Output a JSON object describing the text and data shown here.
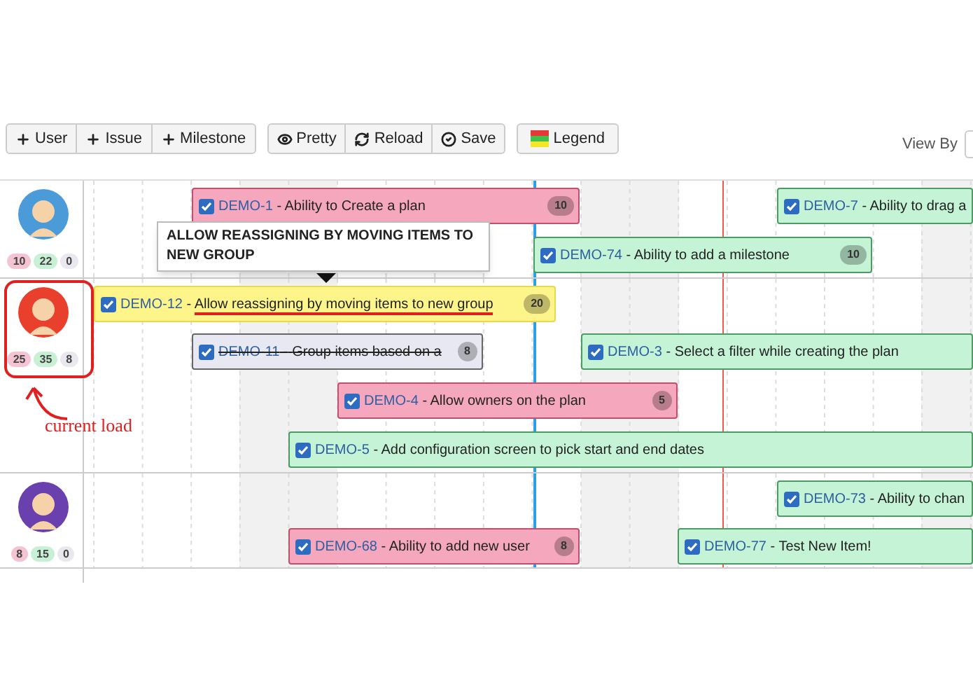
{
  "toolbar": {
    "groups": [
      {
        "buttons": [
          "User",
          "Issue",
          "Milestone"
        ]
      },
      {
        "buttons": [
          "Pretty",
          "Reload",
          "Save"
        ]
      },
      {
        "buttons": [
          "Legend"
        ]
      }
    ],
    "view_by": "View By"
  },
  "separator": "-",
  "tooltip": {
    "text": "ALLOW REASSIGNING BY MOVING ITEMS TO NEW GROUP"
  },
  "annotation": {
    "text": "current load"
  },
  "users": [
    {
      "counts": [
        {
          "value": "10",
          "color": "#f5c4d2"
        },
        {
          "value": "22",
          "color": "#c8f0d4"
        },
        {
          "value": "0",
          "color": "#e8e8ee"
        }
      ],
      "color": "#4a9bd8",
      "highlighted": false,
      "items": [
        {
          "key": "DEMO-1",
          "title": "Ability to Create a plan",
          "badge": "10",
          "color": "#f4a7bd",
          "checked": true,
          "done": false,
          "underlined": false
        },
        {
          "key": "DEMO-7",
          "title": "Ability to drag a",
          "color": "#c4f3d6",
          "checked": true,
          "done": false,
          "underlined": false
        },
        {
          "key": "DEMO-74",
          "title": "Ability to add a milestone",
          "badge": "10",
          "color": "#c4f3d6",
          "checked": true,
          "done": false,
          "underlined": false
        }
      ]
    },
    {
      "counts": [
        {
          "value": "25",
          "color": "#f5c4d2"
        },
        {
          "value": "35",
          "color": "#c8f0d4"
        },
        {
          "value": "8",
          "color": "#e8e8ee"
        }
      ],
      "color": "#e8402c",
      "highlighted": true,
      "items": [
        {
          "key": "DEMO-12",
          "title": "Allow reassigning by moving items to new group",
          "badge": "20",
          "color": "#fdf58a",
          "checked": true,
          "done": false,
          "underlined": true
        },
        {
          "key": "DEMO-11",
          "title": "Group items based on a",
          "badge": "8",
          "color": "#e8e8f2",
          "checked": true,
          "done": true,
          "underlined": false
        },
        {
          "key": "DEMO-3",
          "title": "Select a filter while creating the plan",
          "color": "#c4f3d6",
          "checked": true,
          "done": false,
          "underlined": false
        },
        {
          "key": "DEMO-4",
          "title": "Allow owners on the plan",
          "badge": "5",
          "color": "#f4a7bd",
          "checked": true,
          "done": false,
          "underlined": false
        },
        {
          "key": "DEMO-5",
          "title": "Add configuration screen to pick start and end dates",
          "color": "#c4f3d6",
          "checked": true,
          "done": false,
          "underlined": false
        }
      ]
    },
    {
      "counts": [
        {
          "value": "8",
          "color": "#f5c4d2"
        },
        {
          "value": "15",
          "color": "#c8f0d4"
        },
        {
          "value": "0",
          "color": "#e8e8ee"
        }
      ],
      "color": "#6a3fae",
      "highlighted": false,
      "items": [
        {
          "key": "DEMO-73",
          "title": "Ability to chan",
          "color": "#c4f3d6",
          "checked": true,
          "done": false,
          "underlined": false
        },
        {
          "key": "DEMO-68",
          "title": "Ability to add new user",
          "badge": "8",
          "color": "#f4a7bd",
          "checked": true,
          "done": false,
          "underlined": false
        },
        {
          "key": "DEMO-77",
          "title": "Test New Item!",
          "color": "#c4f3d6",
          "checked": true,
          "done": false,
          "underlined": false
        }
      ]
    }
  ]
}
